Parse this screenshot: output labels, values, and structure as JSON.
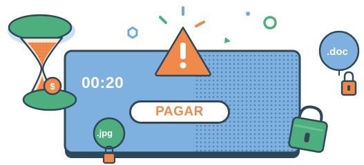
{
  "timer": {
    "value": "00:20"
  },
  "pay_button": {
    "label": "PAGAR"
  },
  "files": {
    "doc_label": ".doc",
    "jpg_label": ".jpg"
  },
  "icons": {
    "hourglass": "hourglass-icon",
    "coin": "dollar-coin-icon",
    "warning": "warning-triangle-icon",
    "padlock": "padlock-icon"
  },
  "colors": {
    "window_blue": "#6fa8dc",
    "outline": "#2f4858",
    "orange": "#f08a4b",
    "green": "#4caf7d",
    "dark_green": "#2e8b61"
  }
}
